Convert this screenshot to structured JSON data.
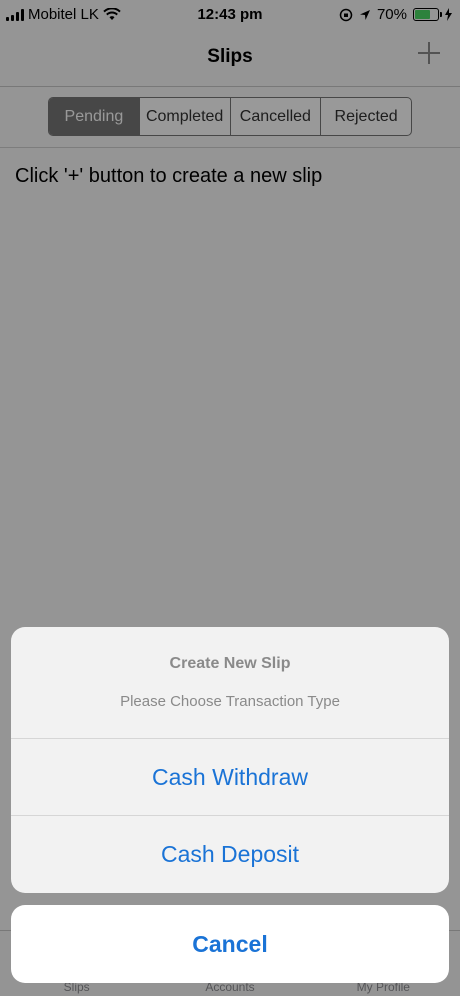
{
  "status_bar": {
    "carrier": "Mobitel LK",
    "time": "12:43 pm",
    "battery_percent": "70%",
    "battery_level": 0.7
  },
  "nav": {
    "title": "Slips"
  },
  "segments": [
    {
      "label": "Pending",
      "active": true
    },
    {
      "label": "Completed",
      "active": false
    },
    {
      "label": "Cancelled",
      "active": false
    },
    {
      "label": "Rejected",
      "active": false
    }
  ],
  "main": {
    "empty_message": "Click '+' button to create a new slip"
  },
  "tab_bar": {
    "items": [
      {
        "label": "Slips"
      },
      {
        "label": "Accounts"
      },
      {
        "label": "My Profile"
      }
    ]
  },
  "action_sheet": {
    "title": "Create New Slip",
    "message": "Please Choose Transaction Type",
    "actions": [
      {
        "label": "Cash Withdraw"
      },
      {
        "label": "Cash Deposit"
      }
    ],
    "cancel_label": "Cancel"
  },
  "colors": {
    "accent": "#1a73d6",
    "battery_fill": "#4cd964"
  }
}
